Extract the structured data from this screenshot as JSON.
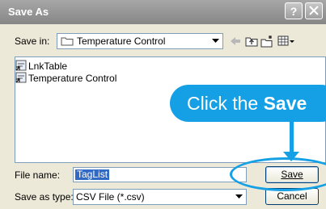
{
  "window": {
    "title": "Save As",
    "help_glyph": "?"
  },
  "toolbar": {
    "save_in_label": "Save in:",
    "save_in_value": "Temperature Control",
    "icons": [
      "back-arrow-icon",
      "up-folder-icon",
      "new-folder-icon",
      "views-menu-icon"
    ]
  },
  "file_list": {
    "items": [
      {
        "label": "LnkTable",
        "icon": "shortcut-icon"
      },
      {
        "label": "Temperature Control",
        "icon": "shortcut-icon"
      }
    ]
  },
  "callout": {
    "prefix": "Click the ",
    "emphasis": "Save",
    "color": "#15a0e6"
  },
  "form": {
    "file_name_label": "File name:",
    "file_name_value": "TagList",
    "save_as_type_label": "Save as type:",
    "save_as_type_value": "CSV File (*.csv)"
  },
  "buttons": {
    "save": "Save",
    "cancel": "Cancel"
  }
}
